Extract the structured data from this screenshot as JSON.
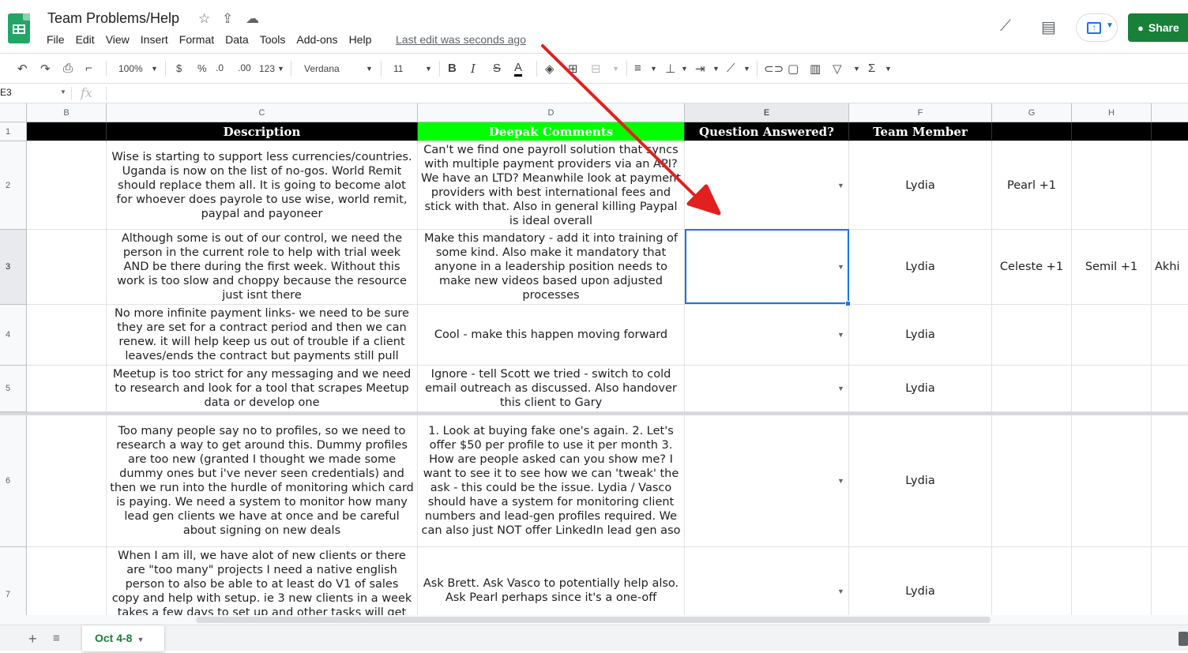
{
  "app": {
    "title": "Team Problems/Help",
    "last_edit": "Last edit was seconds ago",
    "share_label": "Share",
    "accent": "#188038",
    "menus": [
      "File",
      "Edit",
      "View",
      "Insert",
      "Format",
      "Data",
      "Tools",
      "Add-ons",
      "Help"
    ]
  },
  "toolbar": {
    "zoom": "100%",
    "currency": "$",
    "percent": "%",
    "dec_less": ".0",
    "dec_more": ".00",
    "format_more": "123",
    "font": "Verdana",
    "font_size": "11",
    "bold": "B",
    "italic": "I",
    "strike": "S",
    "text_color": "A"
  },
  "formula_bar": {
    "namebox": "E3",
    "fx": "fx"
  },
  "columns": [
    "B",
    "C",
    "D",
    "E",
    "F",
    "G",
    "H"
  ],
  "rows": [
    "1",
    "2",
    "3",
    "4",
    "5",
    "6",
    "7"
  ],
  "header_row": {
    "description": "Description",
    "deepak": "Deepak Comments",
    "answered": "Question Answered?",
    "member": "Team Member"
  },
  "data_rows": [
    {
      "description": "Wise is starting to support less currencies/countries. Uganda is now on the list of no-gos. World Remit should replace them all. It is going to become alot for whoever does payrole to use wise, world remit, paypal and payoneer",
      "comment": "Can't we find one payroll solution that syncs with multiple payment providers via an API? We have an LTD? Meanwhile look at payment providers with best international fees and stick with that. Also in general killing Paypal is ideal overall",
      "member": "Lydia",
      "g": "Pearl +1",
      "h": "",
      "i": ""
    },
    {
      "description": "Although some is out of our control, we need the person in the current role to help with trial week AND be there during the first week. Without this work is too slow and choppy because the resource just isnt there",
      "comment": "Make this mandatory - add it into training of some kind. Also make it mandatory that anyone in a leadership position needs to make new videos based upon adjusted processes",
      "member": "Lydia",
      "g": "Celeste +1",
      "h": "Semil +1",
      "i": "Akhi"
    },
    {
      "description": "No more infinite payment links- we need to be sure they are set for a contract period and then we can renew. it will help keep us out of trouble if a client leaves/ends the contract but payments still pull",
      "comment": "Cool - make this happen moving forward",
      "member": "Lydia",
      "g": "",
      "h": "",
      "i": ""
    },
    {
      "description": "Meetup is too strict for any messaging and we need to research and look for a tool that scrapes Meetup data or develop one",
      "comment": "Ignore - tell Scott we tried - switch to cold email outreach as discussed. Also handover this client to Gary",
      "member": "Lydia",
      "g": "",
      "h": "",
      "i": ""
    },
    {
      "description": "Too many people say no to profiles, so we need to research a way to get around this. Dummy profiles are too new (granted I thought we made some dummy ones but i've never seen credentials) and then we run into the hurdle of monitoring which card is paying. We need a system to monitor how many lead gen clients we have at once and be careful about signing on new deals",
      "comment": "1. Look at buying fake one's again. 2. Let's offer $50 per profile to use it per month 3. How are people asked can you show me? I want to see it to see how we can 'tweak' the ask - this could be the issue. Lydia / Vasco should have a system for monitoring client numbers and lead-gen profiles required. We can also just NOT offer LinkedIn lead gen aso",
      "member": "Lydia",
      "g": "",
      "h": "",
      "i": ""
    },
    {
      "description": "When I am ill, we have alot of new clients or there are \"too many\" projects I need a native english person to also be able to at least do V1 of sales copy and help with setup. ie 3 new clients in a week takes a few days to set up and other tasks will get",
      "comment": "Ask Brett. Ask Vasco to potentially help also. Ask Pearl perhaps since it's a one-off",
      "member": "Lydia",
      "g": "",
      "h": "",
      "i": ""
    }
  ],
  "sheet_tab": "Oct 4-8"
}
